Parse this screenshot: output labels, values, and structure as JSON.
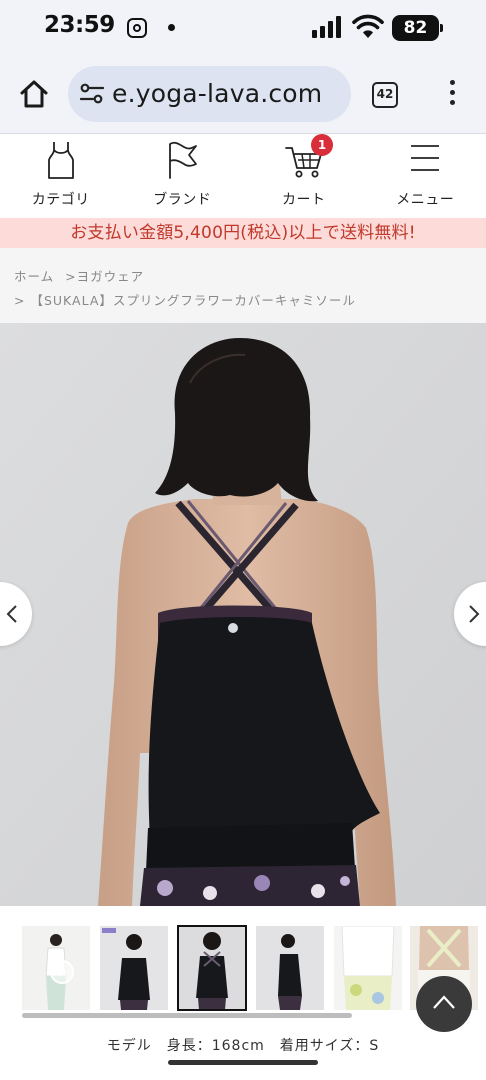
{
  "status_bar": {
    "time": "23:59",
    "battery": "82",
    "icons": [
      "instagram-icon",
      "dot-icon",
      "signal-icon",
      "wifi-icon",
      "battery-icon"
    ]
  },
  "browser": {
    "url": "e.yoga-lava.com",
    "tab_count": "42",
    "icons": [
      "home-icon",
      "site-settings-icon",
      "tabs-icon",
      "more-menu-icon"
    ]
  },
  "site_nav": {
    "items": [
      {
        "label": "カテゴリ",
        "icon": "tank-top-icon"
      },
      {
        "label": "ブランド",
        "icon": "flag-icon"
      },
      {
        "label": "カート",
        "icon": "cart-icon"
      },
      {
        "label": "メニュー",
        "icon": "hamburger-icon"
      }
    ],
    "cart_count": "1"
  },
  "promo": {
    "text": "お支払い金額5,400円(税込)以上で送料無料!"
  },
  "breadcrumb": {
    "items": [
      {
        "label": "ホーム",
        "prefix": ""
      },
      {
        "label": "ヨガウェア",
        "prefix": ">"
      },
      {
        "label": "【SUKALA】スプリングフラワーカバーキャミソール",
        "prefix": ">"
      }
    ]
  },
  "gallery": {
    "thumbnail_count": 6,
    "selected_index": 2,
    "prev_icon": "chevron-left-icon",
    "next_icon": "chevron-right-icon"
  },
  "caption": {
    "text": "モデル　身長：168cm　着用サイズ：S"
  },
  "colors": {
    "promo_bg": "#fcdbd9",
    "promo_text": "#c0392b",
    "badge": "#d92d3a",
    "chrome_bg": "#f1f3f8",
    "url_pill": "#dde3f0"
  }
}
